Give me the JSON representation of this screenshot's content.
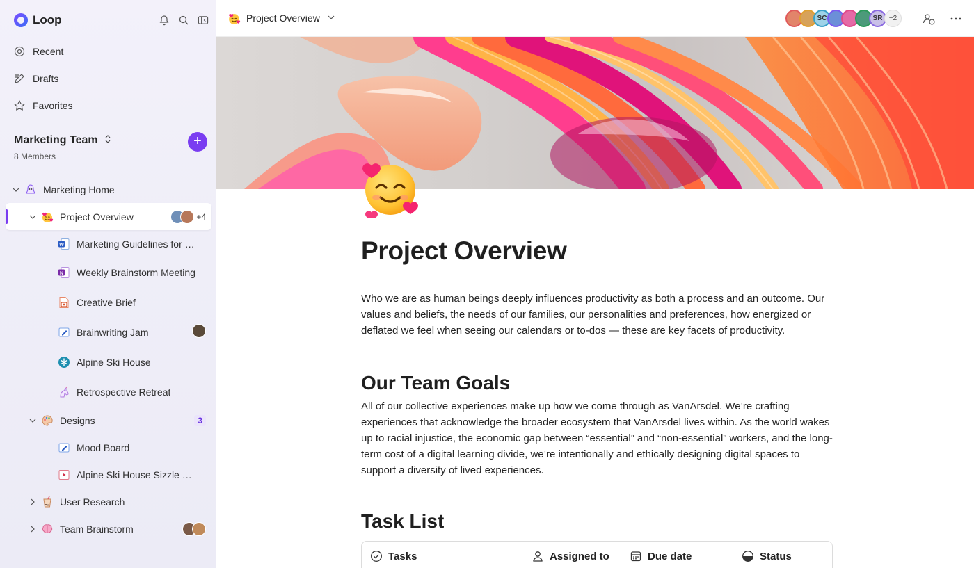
{
  "app": {
    "name": "Loop"
  },
  "nav": [
    {
      "label": "Recent",
      "icon": "recent-icon"
    },
    {
      "label": "Drafts",
      "icon": "drafts-icon"
    },
    {
      "label": "Favorites",
      "icon": "star-icon"
    }
  ],
  "workspace": {
    "name": "Marketing Team",
    "members": "8 Members"
  },
  "tree": {
    "home": "Marketing Home",
    "project_overview": {
      "label": "Project Overview",
      "more": "+4"
    },
    "children": [
      "Marketing Guidelines for V...",
      "Weekly Brainstorm Meeting",
      "Creative Brief",
      "Brainwriting Jam",
      "Alpine Ski House",
      "Retrospective Retreat"
    ],
    "designs": {
      "label": "Designs",
      "count": "3"
    },
    "design_children": [
      "Mood Board",
      "Alpine Ski House Sizzle Re..."
    ],
    "user_research": "User Research",
    "team_brainstorm": "Team Brainstorm"
  },
  "topbar": {
    "title": "Project Overview",
    "collaborators": [
      {
        "initials": "",
        "color": "#e2846a"
      },
      {
        "initials": "",
        "color": "#d7a25a"
      },
      {
        "initials": "SC",
        "color": "#9fd3e8"
      },
      {
        "initials": "",
        "color": "#6c8fd8"
      },
      {
        "initials": "",
        "color": "#e46aa6"
      },
      {
        "initials": "",
        "color": "#4c9a7a"
      },
      {
        "initials": "SR",
        "color": "#c9c0e8"
      }
    ],
    "extra": "+2"
  },
  "document": {
    "title": "Project Overview",
    "intro": "Who we are as human beings deeply influences productivity as both a process and an outcome. Our values and beliefs, the needs of our families, our personalities and preferences, how energized or deflated we feel when seeing our calendars or to-dos — these are key facets of productivity.",
    "goals_heading": "Our Team Goals",
    "goals_text": "All of our collective experiences make up how we come through as VanArsdel. We’re crafting experiences that acknowledge the broader ecosystem that VanArsdel lives within. As the world wakes up to racial injustice, the economic gap between “essential” and “non-essential” workers, and the long-term cost of a digital learning divide, we’re intentionally and ethically designing digital spaces to support a diversity of lived experiences.",
    "tasks_heading": "Task List",
    "task_columns": [
      "Tasks",
      "Assigned to",
      "Due date",
      "Status"
    ]
  },
  "colors": {
    "accent": "#7a3df1"
  }
}
